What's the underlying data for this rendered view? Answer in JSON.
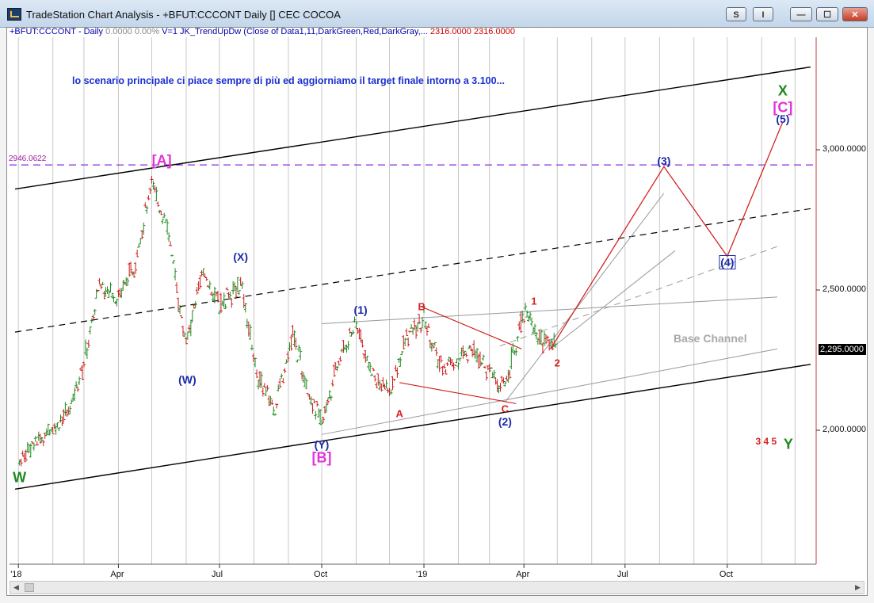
{
  "window": {
    "title": "TradeStation Chart Analysis - +BFUT:CCCONT Daily [] CEC COCOA",
    "buttons": {
      "s": "S",
      "i": "I",
      "minimize": "—",
      "maximize": "☐",
      "close": "✕"
    }
  },
  "study_line": {
    "symbol": "+BFUT:CCCONT - Daily",
    "values": "0.0000  0.00%",
    "indicator": "V=1  JK_TrendUpDw (Close of Data1,11,DarkGreen,Red,DarkGray,...",
    "ind_values": "2316.0000  2316.0000"
  },
  "comment": "lo scenario principale ci piace sempre di più ed aggiorniamo il target finale intorno a 3.100...",
  "level_tag": "2946.0622",
  "price_tag": "2,295.0000",
  "base_channel_label": "Base Channel",
  "colors": {
    "up_bar": "#1d8a1d",
    "down_bar": "#cc1a1a",
    "wave_blue": "#1c2aa8",
    "wave_red": "#d42323",
    "wave_magenta": "#e432d8",
    "wave_green": "#1d8a1d",
    "level_line": "#8a2be2"
  },
  "chart_data": {
    "type": "ohlc",
    "symbol": "+BFUT:CCCONT",
    "ylim": [
      1500,
      3500
    ],
    "y_ticks": [
      "3,000.0000",
      "2,500.0000",
      "2,000.0000"
    ],
    "x_ticks": [
      "'18",
      "Apr",
      "Jul",
      "Oct",
      "'19",
      "Apr",
      "Jul",
      "Oct"
    ],
    "level_line": 2946.0622,
    "last_price": 2295,
    "wave_labels": [
      {
        "text": "[A]",
        "color": "magenta",
        "date": "2018-05-10",
        "price": 2960
      },
      {
        "text": "(X)",
        "color": "blue",
        "date": "2018-07-20",
        "price": 2620
      },
      {
        "text": "(W)",
        "color": "blue",
        "date": "2018-06-02",
        "price": 2180
      },
      {
        "text": "(Y)",
        "color": "blue",
        "date": "2018-10-01",
        "price": 1950
      },
      {
        "text": "[B]",
        "color": "magenta",
        "date": "2018-10-01",
        "price": 1900
      },
      {
        "text": "(1)",
        "color": "blue",
        "date": "2018-11-05",
        "price": 2430
      },
      {
        "text": "A",
        "color": "red",
        "date": "2018-12-10",
        "price": 2060
      },
      {
        "text": "B",
        "color": "red",
        "date": "2018-12-30",
        "price": 2440
      },
      {
        "text": "C",
        "color": "red",
        "date": "2019-03-15",
        "price": 2075
      },
      {
        "text": "(2)",
        "color": "blue",
        "date": "2019-03-15",
        "price": 2030
      },
      {
        "text": "1",
        "color": "red",
        "date": "2019-04-10",
        "price": 2460
      },
      {
        "text": "2",
        "color": "red",
        "date": "2019-05-01",
        "price": 2240
      },
      {
        "text": "(3)",
        "color": "blue",
        "date": "2019-08-05",
        "price": 2960
      },
      {
        "text": "(4)",
        "color": "blue",
        "date": "2019-10-01",
        "price": 2600
      },
      {
        "text": "(5)",
        "color": "blue",
        "date": "2019-11-20",
        "price": 3110
      },
      {
        "text": "[C]",
        "color": "magenta",
        "date": "2019-11-20",
        "price": 3150
      },
      {
        "text": "X",
        "color": "green",
        "date": "2019-11-20",
        "price": 3210
      },
      {
        "text": "W",
        "color": "green",
        "date": "2018-01-02",
        "price": 1830
      },
      {
        "text": "Y",
        "color": "green",
        "date": "2019-11-25",
        "price": 1950
      },
      {
        "text": "3 4 5",
        "color": "red",
        "date": "2019-11-05",
        "price": 1960
      }
    ],
    "projection": [
      {
        "date": "2019-04-25",
        "price": 2290
      },
      {
        "date": "2019-08-05",
        "price": 2940
      },
      {
        "date": "2019-10-01",
        "price": 2620
      },
      {
        "date": "2019-11-20",
        "price": 3100
      }
    ],
    "bars": [
      {
        "date": "2018-01-02",
        "o": 1880,
        "h": 1910,
        "l": 1840,
        "c": 1900
      },
      {
        "date": "2018-01-15",
        "o": 1900,
        "h": 1960,
        "l": 1880,
        "c": 1950
      },
      {
        "date": "2018-02-01",
        "o": 1950,
        "h": 2030,
        "l": 1930,
        "c": 2010
      },
      {
        "date": "2018-02-15",
        "o": 2010,
        "h": 2080,
        "l": 1990,
        "c": 2060
      },
      {
        "date": "2018-03-01",
        "o": 2060,
        "h": 2260,
        "l": 2050,
        "c": 2240
      },
      {
        "date": "2018-03-15",
        "o": 2240,
        "h": 2560,
        "l": 2230,
        "c": 2520
      },
      {
        "date": "2018-04-01",
        "o": 2520,
        "h": 2620,
        "l": 2450,
        "c": 2480
      },
      {
        "date": "2018-04-15",
        "o": 2480,
        "h": 2600,
        "l": 2430,
        "c": 2580
      },
      {
        "date": "2018-05-01",
        "o": 2580,
        "h": 2960,
        "l": 2570,
        "c": 2880
      },
      {
        "date": "2018-05-15",
        "o": 2880,
        "h": 2900,
        "l": 2700,
        "c": 2720
      },
      {
        "date": "2018-06-01",
        "o": 2720,
        "h": 2730,
        "l": 2260,
        "c": 2300
      },
      {
        "date": "2018-06-15",
        "o": 2300,
        "h": 2580,
        "l": 2280,
        "c": 2560
      },
      {
        "date": "2018-07-01",
        "o": 2560,
        "h": 2600,
        "l": 2420,
        "c": 2450
      },
      {
        "date": "2018-07-20",
        "o": 2450,
        "h": 2630,
        "l": 2440,
        "c": 2520
      },
      {
        "date": "2018-08-05",
        "o": 2520,
        "h": 2530,
        "l": 2150,
        "c": 2180
      },
      {
        "date": "2018-08-20",
        "o": 2180,
        "h": 2200,
        "l": 2040,
        "c": 2080
      },
      {
        "date": "2018-09-05",
        "o": 2080,
        "h": 2380,
        "l": 2070,
        "c": 2340
      },
      {
        "date": "2018-09-20",
        "o": 2340,
        "h": 2350,
        "l": 2100,
        "c": 2130
      },
      {
        "date": "2018-10-01",
        "o": 2130,
        "h": 2140,
        "l": 1980,
        "c": 2020
      },
      {
        "date": "2018-10-15",
        "o": 2020,
        "h": 2260,
        "l": 2010,
        "c": 2240
      },
      {
        "date": "2018-11-01",
        "o": 2240,
        "h": 2420,
        "l": 2220,
        "c": 2380
      },
      {
        "date": "2018-11-15",
        "o": 2380,
        "h": 2390,
        "l": 2180,
        "c": 2200
      },
      {
        "date": "2018-12-01",
        "o": 2200,
        "h": 2220,
        "l": 2090,
        "c": 2130
      },
      {
        "date": "2018-12-15",
        "o": 2130,
        "h": 2350,
        "l": 2120,
        "c": 2320
      },
      {
        "date": "2019-01-01",
        "o": 2320,
        "h": 2440,
        "l": 2300,
        "c": 2400
      },
      {
        "date": "2019-01-15",
        "o": 2400,
        "h": 2410,
        "l": 2200,
        "c": 2230
      },
      {
        "date": "2019-02-01",
        "o": 2230,
        "h": 2280,
        "l": 2150,
        "c": 2250
      },
      {
        "date": "2019-02-15",
        "o": 2250,
        "h": 2340,
        "l": 2200,
        "c": 2300
      },
      {
        "date": "2019-03-01",
        "o": 2300,
        "h": 2310,
        "l": 2180,
        "c": 2200
      },
      {
        "date": "2019-03-15",
        "o": 2200,
        "h": 2220,
        "l": 2100,
        "c": 2150
      },
      {
        "date": "2019-04-01",
        "o": 2150,
        "h": 2460,
        "l": 2140,
        "c": 2430
      },
      {
        "date": "2019-04-15",
        "o": 2430,
        "h": 2450,
        "l": 2300,
        "c": 2330
      },
      {
        "date": "2019-05-01",
        "o": 2330,
        "h": 2360,
        "l": 2260,
        "c": 2300
      }
    ]
  }
}
